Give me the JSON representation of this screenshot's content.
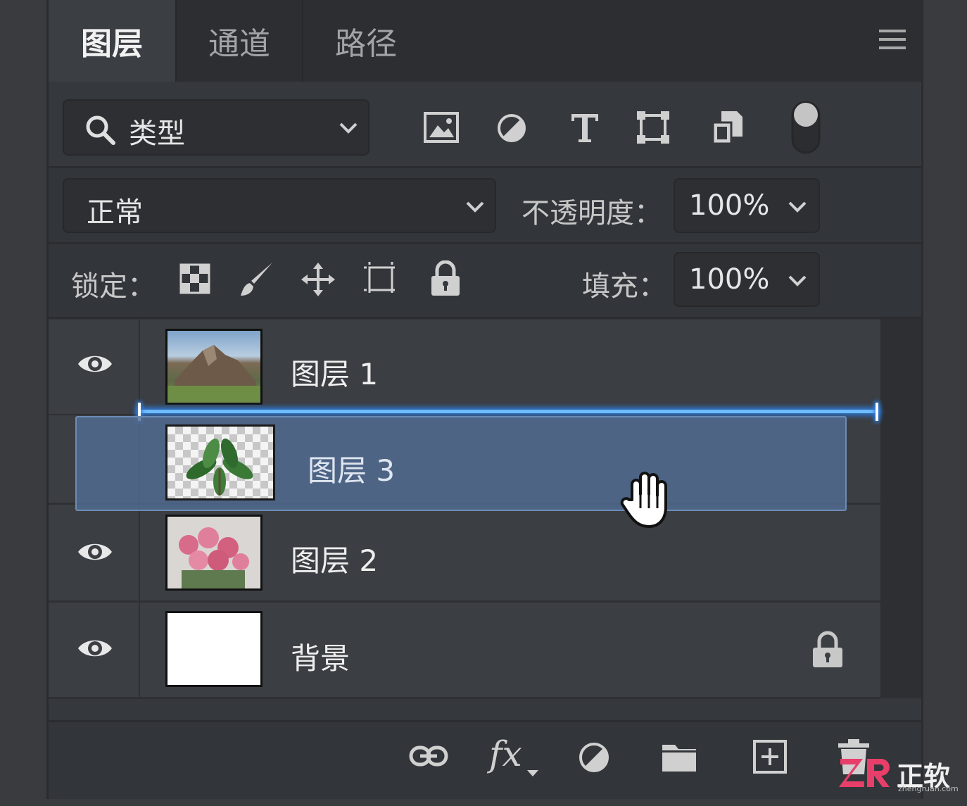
{
  "tabs": [
    {
      "label": "图层"
    },
    {
      "label": "通道"
    },
    {
      "label": "路径"
    }
  ],
  "icons": {
    "menu": "hamburger-menu-icon",
    "search": "search-icon",
    "filters": [
      "image-filter-icon",
      "adjustment-filter-icon",
      "type-filter-icon",
      "shape-filter-icon",
      "smart-object-filter-icon",
      "filter-toggle-icon"
    ],
    "locks": [
      "lock-transparent-icon",
      "lock-paint-icon",
      "lock-move-icon",
      "lock-artboard-icon",
      "lock-all-icon"
    ],
    "bottom": [
      "link-layers-icon",
      "fx-icon",
      "adjustment-layer-icon",
      "group-folder-icon",
      "new-layer-icon",
      "delete-icon"
    ]
  },
  "filter": {
    "value": "类型"
  },
  "blend": {
    "value": "正常"
  },
  "opacity": {
    "label": "不透明度：",
    "value": "100%"
  },
  "lock": {
    "label": "锁定："
  },
  "fill": {
    "label": "填充：",
    "value": "100%"
  },
  "layers": [
    {
      "name": "图层 1",
      "visible": true,
      "thumb": "mountain-landscape"
    },
    {
      "name": "图层 2",
      "visible": true,
      "thumb": "pink-flowers"
    },
    {
      "name": "背景",
      "visible": true,
      "thumb": "white",
      "locked": true
    }
  ],
  "dragging_layer": {
    "name": "图层 3",
    "thumb": "green-leaves-transparent"
  },
  "bottom_bar": {
    "fx_label": "fx"
  },
  "watermark": {
    "brand": "正软",
    "url": "zhengruan.com"
  },
  "colors": {
    "panel": "#323539",
    "selected": "#4a5f7e",
    "drop_line": "#4aa8ff"
  }
}
